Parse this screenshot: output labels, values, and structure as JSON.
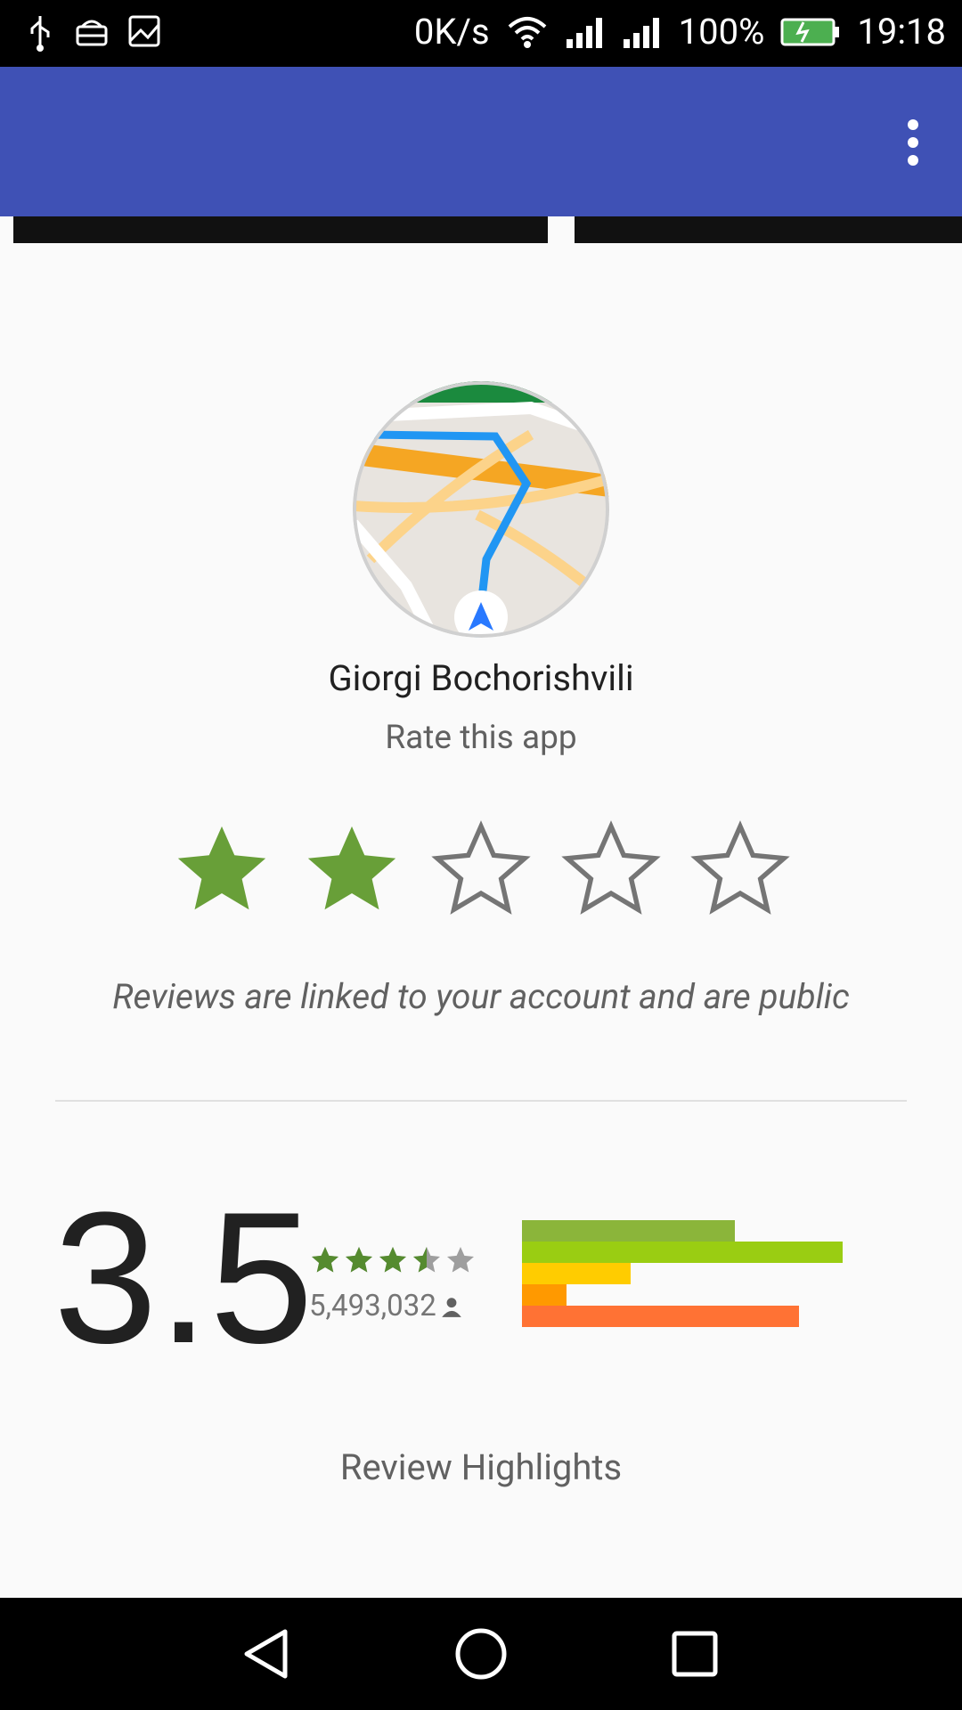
{
  "status_bar": {
    "network_speed": "0K/s",
    "battery": "100%",
    "time": "19:18"
  },
  "profile": {
    "name": "Giorgi Bochorishvili",
    "rate_prompt": "Rate this app",
    "user_rating": 2,
    "max_rating": 5,
    "disclaimer": "Reviews are linked to your account and are public"
  },
  "summary": {
    "average": "3.5",
    "average_value": 3.5,
    "count": "5,493,032",
    "distribution": [
      {
        "stars": 5,
        "color": "#8bb53a",
        "fraction": 0.53
      },
      {
        "stars": 4,
        "color": "#9acd12",
        "fraction": 0.8
      },
      {
        "stars": 3,
        "color": "#ffcc00",
        "fraction": 0.27
      },
      {
        "stars": 2,
        "color": "#ff9900",
        "fraction": 0.11
      },
      {
        "stars": 1,
        "color": "#ff7234",
        "fraction": 0.69
      }
    ]
  },
  "section": {
    "review_highlights": "Review Highlights"
  },
  "colors": {
    "app_bar": "#3f51b5",
    "star_filled": "#689f38",
    "star_empty_stroke": "#757575"
  },
  "icons": {
    "usb": "usb-icon",
    "android": "android-debug-icon",
    "image": "image-icon",
    "wifi": "wifi-icon",
    "signal": "signal-icon",
    "battery": "battery-charging-icon",
    "menu": "more-vert-icon",
    "back": "nav-back-icon",
    "home": "nav-home-icon",
    "recents": "nav-recents-icon",
    "person": "person-icon"
  }
}
